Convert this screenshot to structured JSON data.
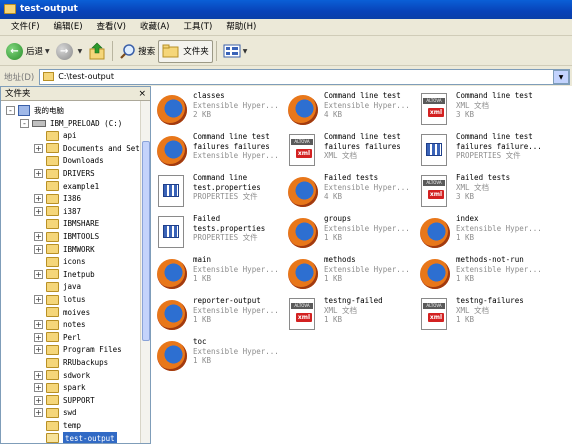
{
  "window": {
    "title": "test-output"
  },
  "menu": [
    "文件(F)",
    "编辑(E)",
    "查看(V)",
    "收藏(A)",
    "工具(T)",
    "帮助(H)"
  ],
  "toolbar": {
    "back": "后退",
    "search": "搜索",
    "folders": "文件夹"
  },
  "address": {
    "label": "地址(D)",
    "value": "C:\\test-output"
  },
  "folders_pane": {
    "title": "文件夹",
    "close": "×",
    "tree": [
      {
        "label": "我的电脑",
        "kind": "pc",
        "expander": "-"
      },
      {
        "label": "IBM_PRELOAD (C:)",
        "kind": "drive",
        "expander": "-"
      },
      {
        "label": "api",
        "kind": "folder",
        "expander": ""
      },
      {
        "label": "Documents and Set",
        "kind": "folder",
        "expander": "+"
      },
      {
        "label": "Downloads",
        "kind": "folder",
        "expander": ""
      },
      {
        "label": "DRIVERS",
        "kind": "folder",
        "expander": "+"
      },
      {
        "label": "example1",
        "kind": "folder",
        "expander": ""
      },
      {
        "label": "I386",
        "kind": "folder",
        "expander": "+"
      },
      {
        "label": "i387",
        "kind": "folder",
        "expander": "+"
      },
      {
        "label": "IBMSHARE",
        "kind": "folder",
        "expander": ""
      },
      {
        "label": "IBMTOOLS",
        "kind": "folder",
        "expander": "+"
      },
      {
        "label": "IBMWORK",
        "kind": "folder",
        "expander": "+"
      },
      {
        "label": "icons",
        "kind": "folder",
        "expander": ""
      },
      {
        "label": "Inetpub",
        "kind": "folder",
        "expander": "+"
      },
      {
        "label": "java",
        "kind": "folder",
        "expander": ""
      },
      {
        "label": "lotus",
        "kind": "folder",
        "expander": "+"
      },
      {
        "label": "moives",
        "kind": "folder",
        "expander": ""
      },
      {
        "label": "notes",
        "kind": "folder",
        "expander": "+"
      },
      {
        "label": "Perl",
        "kind": "folder",
        "expander": "+"
      },
      {
        "label": "Program Files",
        "kind": "folder",
        "expander": "+"
      },
      {
        "label": "RRUbackups",
        "kind": "folder",
        "expander": ""
      },
      {
        "label": "sdwork",
        "kind": "folder",
        "expander": "+"
      },
      {
        "label": "spark",
        "kind": "folder",
        "expander": "+"
      },
      {
        "label": "SUPPORT",
        "kind": "folder",
        "expander": "+"
      },
      {
        "label": "swd",
        "kind": "folder",
        "expander": "+"
      },
      {
        "label": "temp",
        "kind": "folder",
        "expander": ""
      },
      {
        "label": "test-output",
        "kind": "folder-open",
        "expander": "",
        "selected": true
      }
    ]
  },
  "files": [
    {
      "name": "classes",
      "type": "Extensible Hyper...",
      "size": "2 KB",
      "icon": "firefox"
    },
    {
      "name": "Command line test",
      "type": "Extensible Hyper...",
      "size": "4 KB",
      "icon": "firefox"
    },
    {
      "name": "Command line test",
      "type": "XML 文档",
      "size": "3 KB",
      "icon": "altova-xml"
    },
    {
      "name": "Command line test\nfailures failures",
      "type": "Extensible Hyper...",
      "size": "",
      "icon": "firefox"
    },
    {
      "name": "Command line test\nfailures failures",
      "type": "XML 文档",
      "size": "",
      "icon": "altova-xml"
    },
    {
      "name": "Command line test\nfailures failure...",
      "type": "PROPERTIES 文件",
      "size": "",
      "icon": "properties"
    },
    {
      "name": "Command line\ntest.properties",
      "type": "PROPERTIES 文件",
      "size": "",
      "icon": "properties"
    },
    {
      "name": "Failed tests",
      "type": "Extensible Hyper...",
      "size": "4 KB",
      "icon": "firefox"
    },
    {
      "name": "Failed tests",
      "type": "XML 文档",
      "size": "3 KB",
      "icon": "altova-xml"
    },
    {
      "name": "Failed\ntests.properties",
      "type": "PROPERTIES 文件",
      "size": "",
      "icon": "properties"
    },
    {
      "name": "groups",
      "type": "Extensible Hyper...",
      "size": "1 KB",
      "icon": "firefox"
    },
    {
      "name": "index",
      "type": "Extensible Hyper...",
      "size": "1 KB",
      "icon": "firefox"
    },
    {
      "name": "main",
      "type": "Extensible Hyper...",
      "size": "1 KB",
      "icon": "firefox"
    },
    {
      "name": "methods",
      "type": "Extensible Hyper...",
      "size": "1 KB",
      "icon": "firefox"
    },
    {
      "name": "methods-not-run",
      "type": "Extensible Hyper...",
      "size": "1 KB",
      "icon": "firefox"
    },
    {
      "name": "reporter-output",
      "type": "Extensible Hyper...",
      "size": "1 KB",
      "icon": "firefox"
    },
    {
      "name": "testng-failed",
      "type": "XML 文档",
      "size": "1 KB",
      "icon": "altova-xml"
    },
    {
      "name": "testng-failures",
      "type": "XML 文档",
      "size": "1 KB",
      "icon": "altova-xml"
    },
    {
      "name": "toc",
      "type": "Extensible Hyper...",
      "size": "1 KB",
      "icon": "firefox"
    }
  ],
  "icon_text": {
    "altova": "ALTOVA",
    "xml": "xml"
  }
}
